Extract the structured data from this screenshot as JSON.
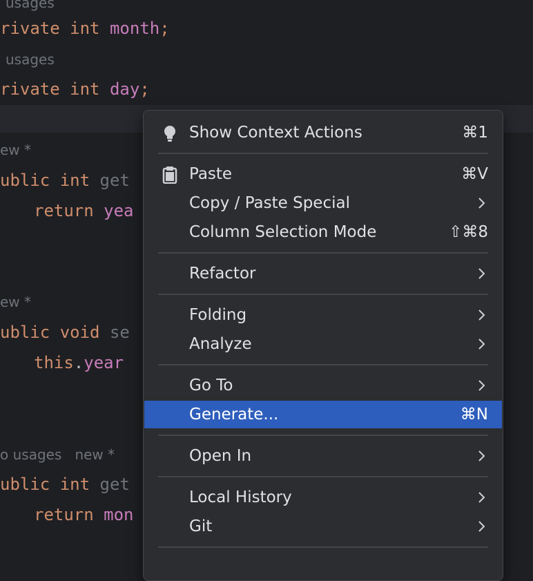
{
  "editor": {
    "hint_usages_top": "usages",
    "line_private_month": {
      "kw1": "rivate",
      "kw2": "int",
      "field": "month",
      "punct": ";"
    },
    "hint_usages_2": "usages",
    "line_private_day": {
      "kw1": "rivate",
      "kw2": "int",
      "field": "day",
      "punct": ";"
    },
    "hint_new_1": "ew *",
    "line_get_year": {
      "kw1": "ublic",
      "kw2": "int",
      "rest": "get"
    },
    "line_return_year": {
      "kw": "return",
      "field": "yea"
    },
    "hint_new_2": "ew *",
    "line_set_year": {
      "kw1": "ublic",
      "kw2": "void",
      "rest": "se"
    },
    "line_this_year": {
      "kw": "this",
      "dot": ".",
      "field": "year"
    },
    "hint_usages_new": {
      "usages": "o usages",
      "new": "new *"
    },
    "line_get_month": {
      "kw1": "ublic",
      "kw2": "int",
      "rest": "get"
    },
    "line_return_month": {
      "kw": "return",
      "field": "mon"
    }
  },
  "context_menu": {
    "items": [
      {
        "label": "Show Context Actions",
        "shortcut": "⌘1",
        "icon": "lightbulb-icon"
      },
      {
        "label": "Paste",
        "shortcut": "⌘V",
        "icon": "clipboard-icon"
      },
      {
        "label": "Copy / Paste Special",
        "submenu": true
      },
      {
        "label": "Column Selection Mode",
        "shortcut": "⇧⌘8"
      },
      {
        "label": "Refactor",
        "submenu": true
      },
      {
        "label": "Folding",
        "submenu": true
      },
      {
        "label": "Analyze",
        "submenu": true
      },
      {
        "label": "Go To",
        "submenu": true
      },
      {
        "label": "Generate...",
        "shortcut": "⌘N",
        "selected": true
      },
      {
        "label": "Open In",
        "submenu": true
      },
      {
        "label": "Local History",
        "submenu": true
      },
      {
        "label": "Git",
        "submenu": true
      }
    ]
  },
  "colors": {
    "selection": "#2e5ebd",
    "menu_background": "#2b2d30",
    "editor_background": "#1e1f22",
    "keyword": "#cf8e6d",
    "field": "#c77dbb"
  }
}
